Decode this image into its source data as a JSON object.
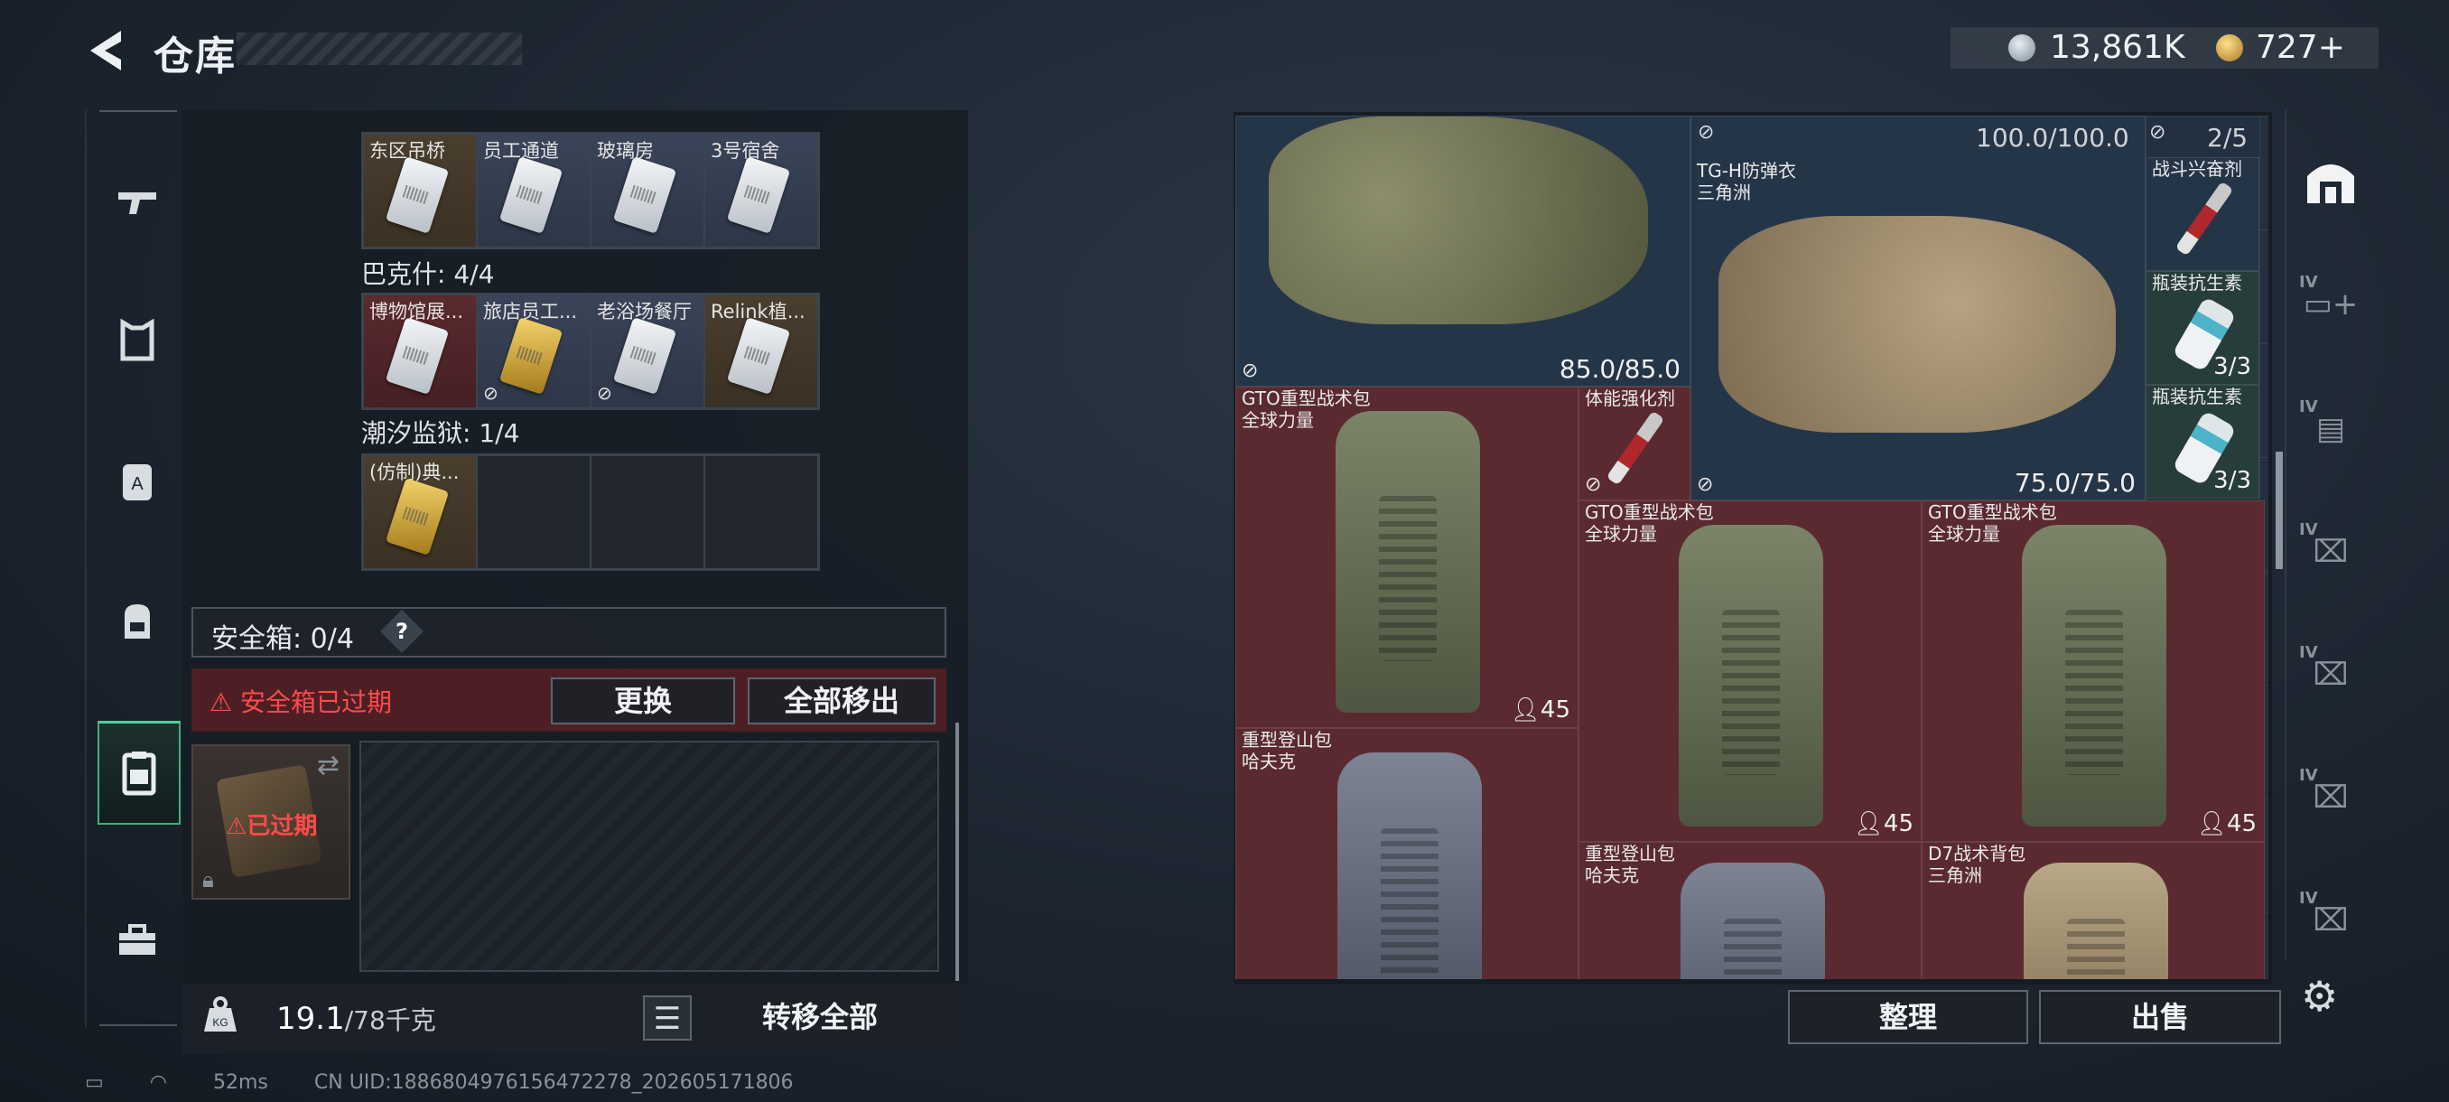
{
  "header": {
    "title": "仓库",
    "currency_silver": "13,861K",
    "currency_gold": "727+"
  },
  "left_nav": {
    "items": [
      "gun-icon",
      "armor-icon",
      "chest-rig-icon",
      "backpack-icon",
      "secure-case-icon",
      "toolbox-icon"
    ],
    "active_index": 4
  },
  "key_sections": [
    {
      "label": "",
      "cells": [
        {
          "name": "东区吊桥",
          "tone": "brown",
          "card": "silver"
        },
        {
          "name": "员工通道",
          "tone": "blue",
          "card": "silver"
        },
        {
          "name": "玻璃房",
          "tone": "blue",
          "card": "silver"
        },
        {
          "name": "3号宿舍",
          "tone": "blue",
          "card": "silver"
        }
      ]
    },
    {
      "label": "巴克什: 4/4",
      "cells": [
        {
          "name": "博物馆展...",
          "tone": "red",
          "card": "silver"
        },
        {
          "name": "旅店员工...",
          "tone": "blue",
          "card": "gold",
          "flag": true
        },
        {
          "name": "老浴场餐厅",
          "tone": "blue",
          "card": "silver",
          "flag": true
        },
        {
          "name": "Relink植...",
          "tone": "brown",
          "card": "silver"
        }
      ]
    },
    {
      "label": "潮汐监狱: 1/4",
      "cells": [
        {
          "name": "(仿制)典...",
          "tone": "brown",
          "card": "gold"
        },
        {
          "name": "",
          "tone": "empty"
        },
        {
          "name": "",
          "tone": "empty"
        },
        {
          "name": "",
          "tone": "empty"
        }
      ]
    }
  ],
  "safe_box": {
    "label": "安全箱: 0/4",
    "help": "?",
    "expired_warning": "安全箱已过期",
    "replace_button": "更换",
    "move_all_button": "全部移出",
    "case_status": "已过期"
  },
  "footer_left": {
    "weight_current": "19.1",
    "weight_max": "/78千克",
    "transfer_button": "转移全部"
  },
  "stash_items": [
    {
      "id": "vest-camo-green",
      "name": "",
      "tone": "blue",
      "value": "85.0/85.0",
      "flag": true
    },
    {
      "id": "tg-h-vest",
      "name": "TG-H防弹衣\n三角洲",
      "tone": "blue",
      "value": "75.0/75.0",
      "durability": "100.0/100.0",
      "flag": true
    },
    {
      "id": "combat-stim",
      "name": "战斗兴奋剂",
      "tone": "blue",
      "value": "",
      "count": "2/5"
    },
    {
      "id": "antibiotic-1",
      "name": "瓶装抗生素",
      "tone": "green",
      "value": "3/3"
    },
    {
      "id": "antibiotic-2",
      "name": "瓶装抗生素",
      "tone": "green",
      "value": "3/3"
    },
    {
      "id": "gto-pack-1",
      "name": "GTO重型战术包\n全球力量",
      "tone": "red",
      "value": "45"
    },
    {
      "id": "stamina-boost",
      "name": "体能强化剂",
      "tone": "red",
      "value": "",
      "flag": true
    },
    {
      "id": "gto-pack-2",
      "name": "GTO重型战术包\n全球力量",
      "tone": "red",
      "value": "45"
    },
    {
      "id": "gto-pack-3",
      "name": "GTO重型战术包\n全球力量",
      "tone": "red",
      "value": "45"
    },
    {
      "id": "mountain-pack-1",
      "name": "重型登山包\n哈夫克",
      "tone": "red",
      "value": ""
    },
    {
      "id": "mountain-pack-2",
      "name": "重型登山包\n哈夫克",
      "tone": "red",
      "value": ""
    },
    {
      "id": "d7-pack",
      "name": "D7战术背包\n三角洲",
      "tone": "red",
      "value": ""
    }
  ],
  "footer_right": {
    "sort_button": "整理",
    "sell_button": "出售"
  },
  "right_nav": {
    "items": [
      "safehouse-icon",
      "medkit-tab-icon",
      "folder-tab-icon",
      "key-tab-icon",
      "key-tab-icon",
      "key-tab-icon",
      "key-tab-icon"
    ],
    "tier_label": "IV"
  },
  "status_bar": {
    "ping": "52ms",
    "uid": "CN UID:1886804976156472278_202605171806"
  }
}
